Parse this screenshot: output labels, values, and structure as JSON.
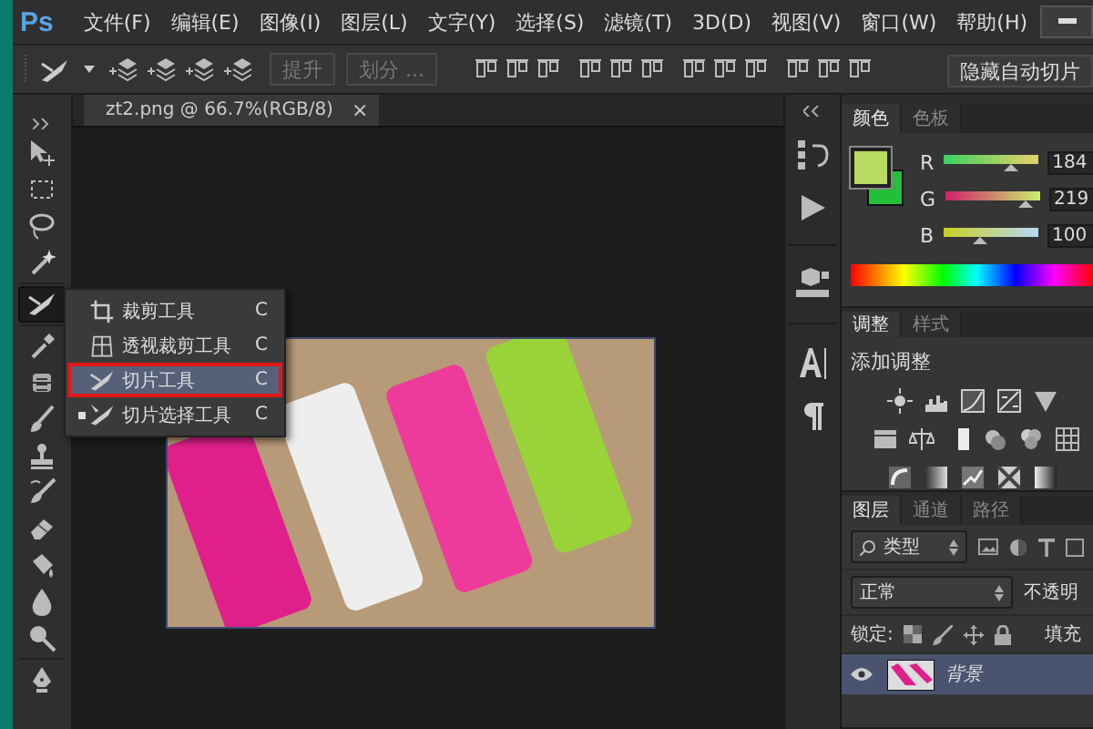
{
  "app": {
    "logo": "Ps"
  },
  "menu": [
    "文件(F)",
    "编辑(E)",
    "图像(I)",
    "图层(L)",
    "文字(Y)",
    "选择(S)",
    "滤镜(T)",
    "3D(D)",
    "视图(V)",
    "窗口(W)",
    "帮助(H)"
  ],
  "options_bar": {
    "buttons": [
      {
        "label": "提升",
        "disabled": true
      },
      {
        "label": "划分 ...",
        "disabled": true
      },
      {
        "label": "隐藏自动切片",
        "disabled": false
      }
    ]
  },
  "tools": [
    {
      "kind": "move",
      "selected": false
    },
    {
      "kind": "marquee",
      "selected": false
    },
    {
      "kind": "lasso",
      "selected": false
    },
    {
      "kind": "wand",
      "selected": false
    },
    {
      "kind": "slice",
      "selected": true
    },
    {
      "kind": "eyedropper",
      "selected": false
    },
    {
      "kind": "patch",
      "selected": false
    },
    {
      "kind": "brush",
      "selected": false
    },
    {
      "kind": "stamp",
      "selected": false
    },
    {
      "kind": "history",
      "selected": false
    },
    {
      "kind": "eraser",
      "selected": false
    },
    {
      "kind": "bucket",
      "selected": false
    },
    {
      "kind": "blur",
      "selected": false
    },
    {
      "kind": "dodge",
      "selected": false
    },
    {
      "kind": "pen",
      "selected": false
    }
  ],
  "document_tab": {
    "title": "zt2.png @ 66.7%(RGB/8)",
    "close": "×"
  },
  "tool_flyout": [
    {
      "kind": "crop",
      "label": "裁剪工具",
      "shortcut": "C",
      "selected": false,
      "active": false
    },
    {
      "kind": "perspective_crop",
      "label": "透视裁剪工具",
      "shortcut": "C",
      "selected": false,
      "active": false
    },
    {
      "kind": "slice",
      "label": "切片工具",
      "shortcut": "C",
      "selected": true,
      "active": false
    },
    {
      "kind": "slice_select",
      "label": "切片选择工具",
      "shortcut": "C",
      "selected": false,
      "active": true
    }
  ],
  "color_panel": {
    "tabs": [
      {
        "label": "颜色",
        "selected": true
      },
      {
        "label": "色板",
        "selected": false
      }
    ],
    "channels": [
      {
        "name": "R",
        "level": 0.722,
        "reading": "184"
      },
      {
        "name": "G",
        "level": 0.859,
        "reading": "219"
      },
      {
        "name": "B",
        "level": 0.392,
        "reading": "100"
      }
    ]
  },
  "adjustments_panel": {
    "tabs": [
      {
        "label": "调整",
        "selected": true
      },
      {
        "label": "样式",
        "selected": false
      }
    ],
    "heading": "添加调整"
  },
  "layers_panel": {
    "tabs": [
      {
        "label": "图层",
        "selected": true
      },
      {
        "label": "通道",
        "selected": false
      },
      {
        "label": "路径",
        "selected": false
      }
    ],
    "filter": "类型",
    "blend_mode": "正常",
    "opacity_label": "不透明",
    "lock_label": "锁定:",
    "fill_label": "填充",
    "layers": [
      {
        "name": "背景",
        "visible": true,
        "selected": true
      }
    ]
  }
}
